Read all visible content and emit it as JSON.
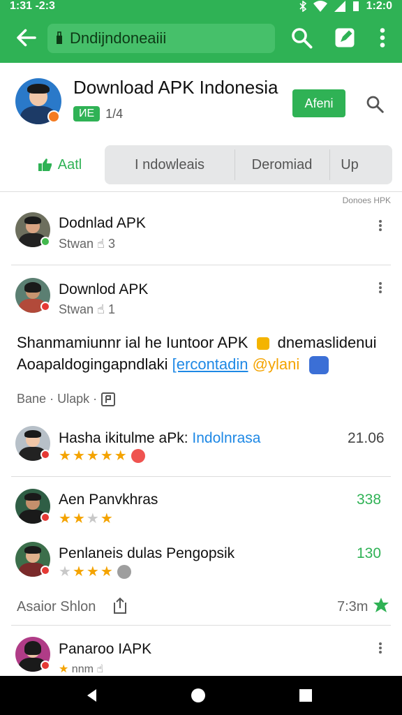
{
  "status": {
    "time": "1:31 -2:3",
    "clock_right": "1:2:0"
  },
  "appbar": {
    "url": "Dndijndoneaiii"
  },
  "header": {
    "title": "Download APK Indonesia",
    "pill": "ИЕ",
    "meta_count": "1/4",
    "action_button": "Afeni"
  },
  "tabs": {
    "active": "Aatl",
    "items": [
      "I ndowleais",
      "Deromiad",
      "Up"
    ]
  },
  "sort_label": "Donoes HPK",
  "posts": [
    {
      "title": "Dodnlad APK",
      "sub": "Stwan",
      "count": "3"
    },
    {
      "title": "Downlod APK",
      "sub": "Stwan",
      "count": "1"
    }
  ],
  "body": {
    "line1": "Shanmamiunnr ial he Iuntoor APK",
    "line1_tail": "dnemaslidenui",
    "line2_pre": "Aoapaldogingapndlaki",
    "line2_link": "[ercontadin",
    "line2_mention": "@ylani",
    "footer_left": "Bane",
    "footer_mid": "Ulapk",
    "sep": "·"
  },
  "reviews": [
    {
      "title_pre": "Hasha ikitulme aPk:",
      "title_link": "Indolnrasa",
      "count": "21.06",
      "rating": 5
    },
    {
      "title_pre": "Aen Panvkhras",
      "title_link": "",
      "count": "338",
      "rating": 3
    },
    {
      "title_pre": "Penlaneis dulas Pengopsik",
      "title_link": "",
      "count": "130",
      "rating": 3
    }
  ],
  "section": {
    "label": "Asaior Shlon",
    "time": "7:3m"
  },
  "last": {
    "title": "Panaroo IAPK",
    "sub": "nnm"
  },
  "colors": {
    "brand": "#2fb255",
    "accent_star": "#f4a300",
    "link": "#1e88e5"
  }
}
